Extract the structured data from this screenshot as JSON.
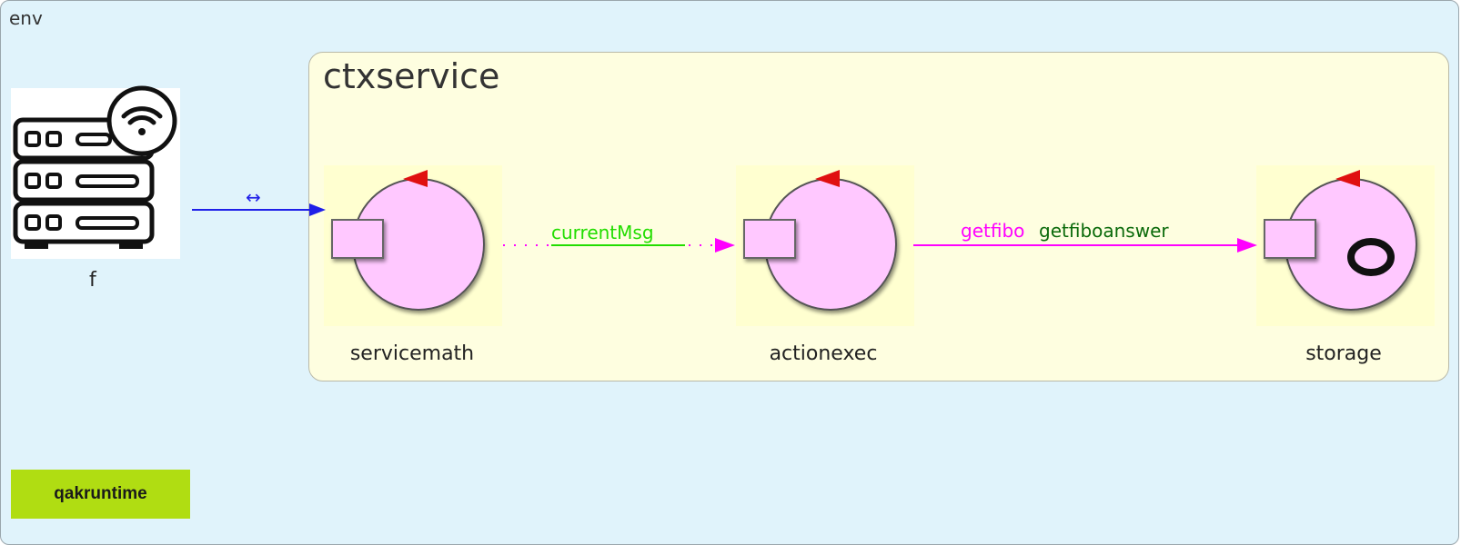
{
  "diagram": {
    "context_env": {
      "label": "env"
    },
    "context_ctx": {
      "label": "ctxservice"
    },
    "external": {
      "label": "f"
    },
    "actors": [
      {
        "id": "servicemath",
        "label": "servicemath"
      },
      {
        "id": "actionexec",
        "label": "actionexec"
      },
      {
        "id": "storage",
        "label": "storage"
      }
    ],
    "edges": {
      "ext_to_servicemath": {
        "label": "↔"
      },
      "servicemath_to_actionexec": {
        "label": "currentMsg"
      },
      "actionexec_to_storage": {
        "label_a": "getfibo",
        "label_b": "getfiboanswer"
      }
    },
    "runtime": {
      "label": "qakruntime"
    },
    "colors": {
      "env_bg": "#e0f3fb",
      "ctx_bg": "#fefee0",
      "actor_bg": "#ffffd0",
      "actor_circle": "#ffc8ff",
      "edge_blue": "#1f1fe8",
      "edge_magenta": "#ff00ff",
      "label_green": "#22dd00",
      "label_darkgreen": "#0a6a0a",
      "runtime_bg": "#b0dd12"
    }
  }
}
